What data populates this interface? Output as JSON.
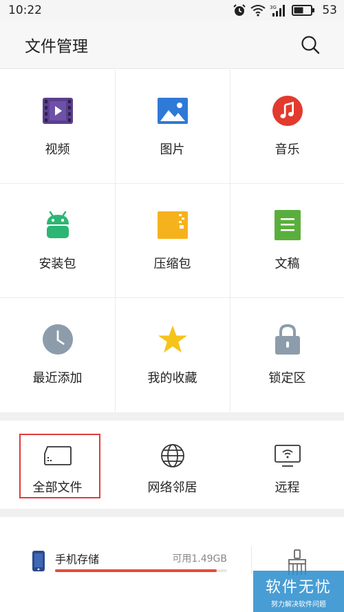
{
  "status_bar": {
    "time": "10:22",
    "battery": "53"
  },
  "header": {
    "title": "文件管理"
  },
  "categories": [
    {
      "label": "视频",
      "icon": "video-icon"
    },
    {
      "label": "图片",
      "icon": "image-icon"
    },
    {
      "label": "音乐",
      "icon": "music-icon"
    },
    {
      "label": "安装包",
      "icon": "android-icon"
    },
    {
      "label": "压缩包",
      "icon": "archive-icon"
    },
    {
      "label": "文稿",
      "icon": "document-icon"
    },
    {
      "label": "最近添加",
      "icon": "clock-icon"
    },
    {
      "label": "我的收藏",
      "icon": "star-icon"
    },
    {
      "label": "锁定区",
      "icon": "lock-icon"
    }
  ],
  "shortcuts": [
    {
      "label": "全部文件",
      "icon": "sd-card-icon"
    },
    {
      "label": "网络邻居",
      "icon": "globe-icon"
    },
    {
      "label": "远程",
      "icon": "remote-screen-icon"
    }
  ],
  "storage": {
    "name": "手机存储",
    "free": "可用1.49GB",
    "used_fraction": 0.94
  },
  "watermark": {
    "title": "软件无忧",
    "subtitle": "努力解决软件问题"
  },
  "colors": {
    "accent_red": "#e03a3a",
    "storage_bar": "#e44c3c"
  }
}
